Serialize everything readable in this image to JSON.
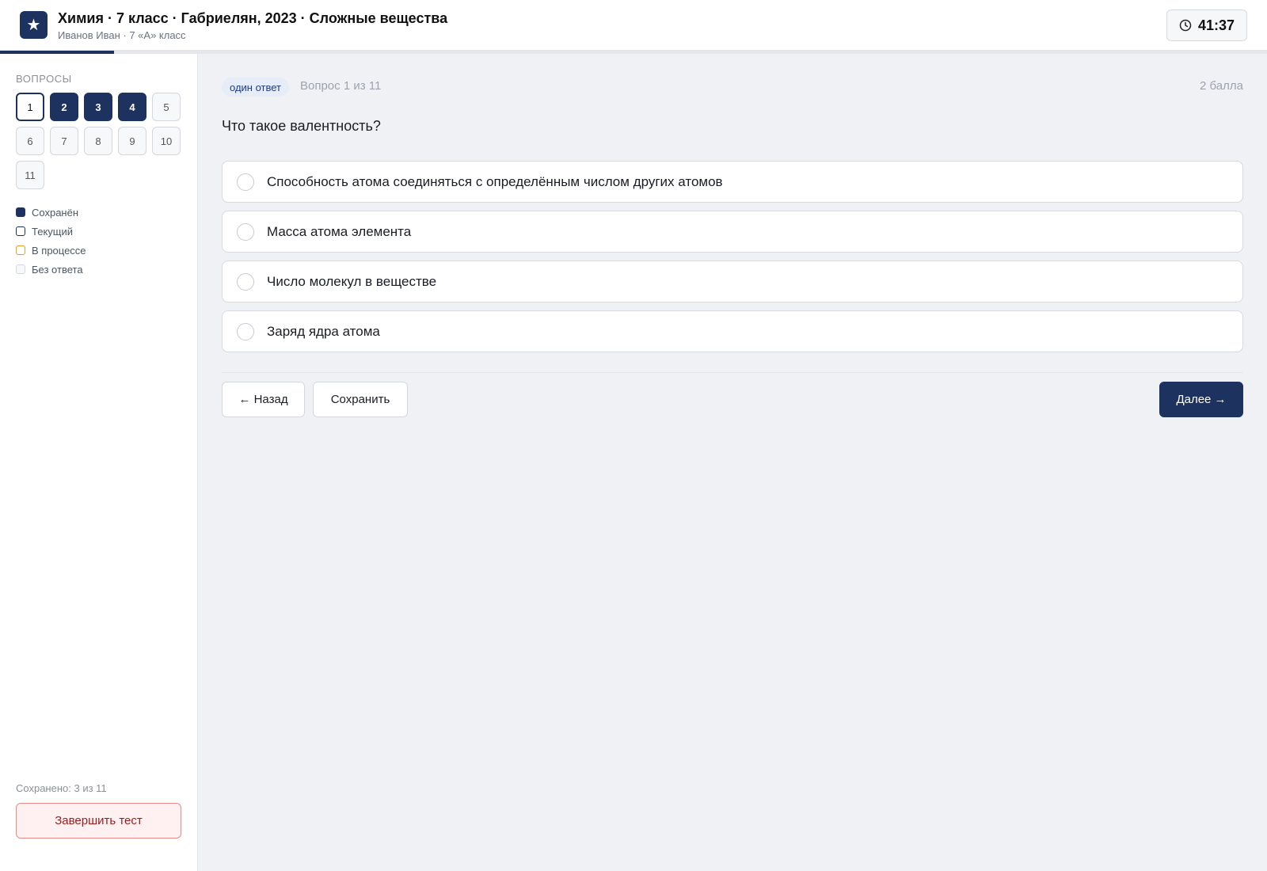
{
  "header": {
    "title": "Химия · 7 класс · Габриелян, 2023 · Сложные вещества",
    "subtitle": "Иванов Иван · 7 «А» класс",
    "logo_glyph": "★",
    "timer": "41:37",
    "progress_fraction": 0.09
  },
  "sidebar": {
    "heading": "ВОПРОСЫ",
    "questions": [
      {
        "number": "1",
        "state": "current"
      },
      {
        "number": "2",
        "state": "saved"
      },
      {
        "number": "3",
        "state": "saved"
      },
      {
        "number": "4",
        "state": "saved"
      },
      {
        "number": "5",
        "state": "none"
      },
      {
        "number": "6",
        "state": "none"
      },
      {
        "number": "7",
        "state": "none"
      },
      {
        "number": "8",
        "state": "none"
      },
      {
        "number": "9",
        "state": "none"
      },
      {
        "number": "10",
        "state": "none"
      },
      {
        "number": "11",
        "state": "none"
      }
    ],
    "legend": {
      "saved": "Сохранён",
      "current": "Текущий",
      "in_progress": "В процессе",
      "no_answer": "Без ответа"
    },
    "saved_count": "Сохранено: 3 из 11",
    "finish_label": "Завершить тест"
  },
  "main": {
    "badge": "один ответ",
    "question_meta": "Вопрос 1 из 11",
    "points": "2 балла",
    "question": "Что такое валентность?",
    "answers": [
      "Способность атома соединяться с определённым числом других атомов",
      "Масса атома элемента",
      "Число молекул в веществе",
      "Заряд ядра атома"
    ],
    "back_label": "← Назад",
    "save_label": "Сохранить",
    "next_label": "Далее →"
  },
  "colors": {
    "accent": "#1e3260",
    "in_progress": "#f0a020",
    "danger": "#9b1c1c"
  }
}
